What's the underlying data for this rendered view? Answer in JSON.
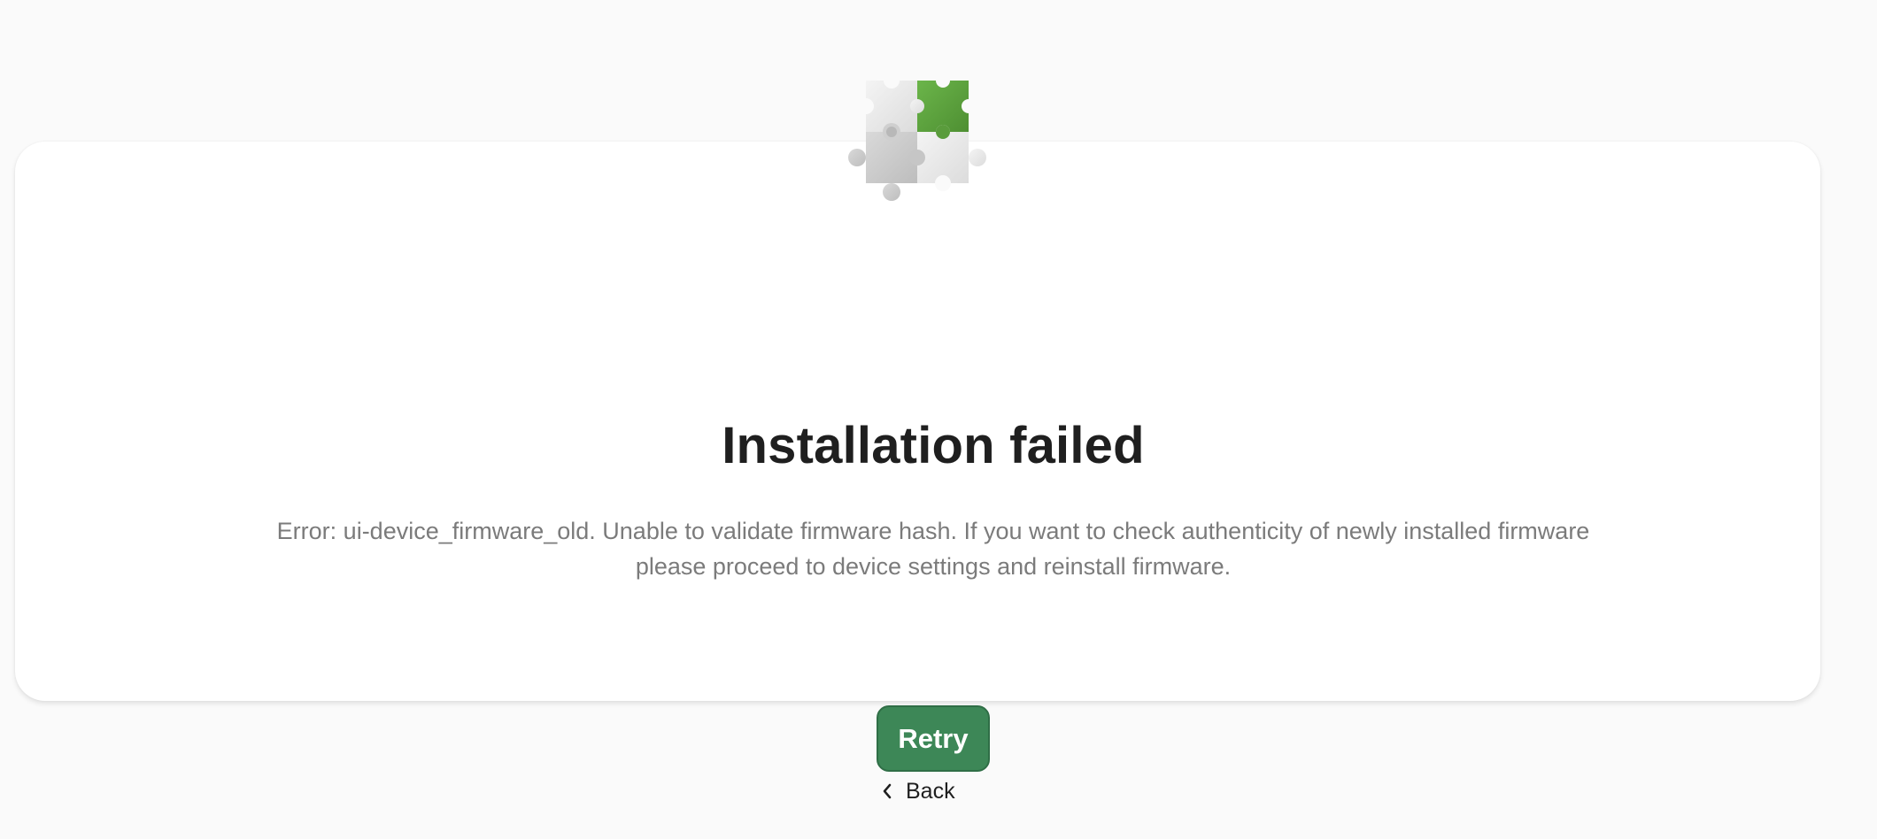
{
  "dialog": {
    "title": "Installation failed",
    "message": "Error: ui-device_firmware_old. Unable to validate firmware hash. If you want to check authenticity of newly installed firmware please proceed to device settings and reinstall firmware.",
    "retry_label": "Retry",
    "illustration_icon": "puzzle-pieces-icon"
  },
  "navigation": {
    "back_label": "Back",
    "back_icon": "chevron-left-icon"
  },
  "colors": {
    "background": "#fafafa",
    "card": "#ffffff",
    "accent": "#3d8757",
    "puzzle_green": "#5ba33e",
    "title": "#1f1f1f",
    "message": "#7b7b7b"
  }
}
